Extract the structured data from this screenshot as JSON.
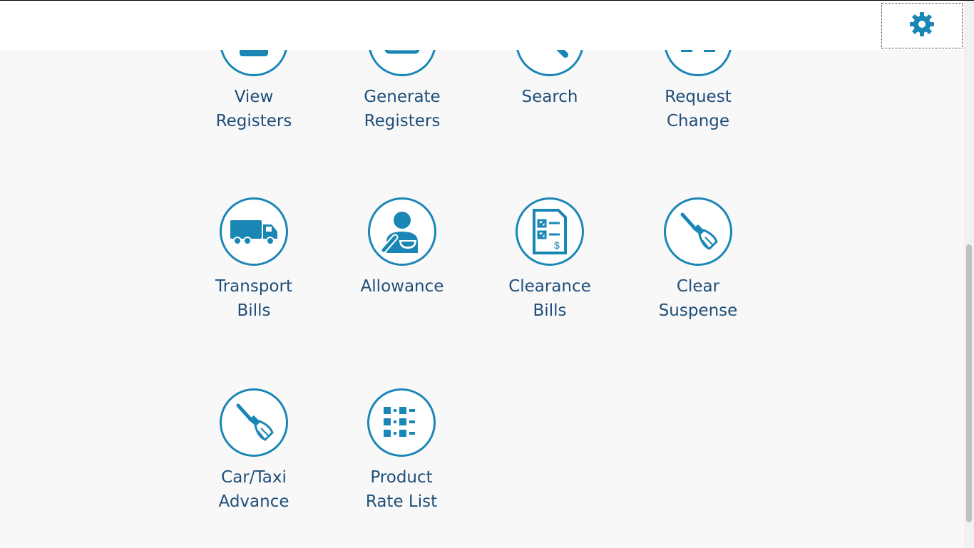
{
  "header": {
    "settings_icon": "gear-icon",
    "accent": "#1a86b5"
  },
  "tiles": [
    {
      "label": "View\nRegisters",
      "icon": "register-book-icon"
    },
    {
      "label": "Generate\nRegisters",
      "icon": "generate-register-icon"
    },
    {
      "label": "Search",
      "icon": "magnifier-icon"
    },
    {
      "label": "Request\nChange",
      "icon": "request-change-icon"
    },
    {
      "label": "Transport\nBills",
      "icon": "truck-icon"
    },
    {
      "label": "Allowance",
      "icon": "person-bowl-icon"
    },
    {
      "label": "Clearance\nBills",
      "icon": "checklist-bill-icon"
    },
    {
      "label": "Clear\nSuspense",
      "icon": "broom-icon"
    },
    {
      "label": "Car/Taxi\nAdvance",
      "icon": "broom-icon"
    },
    {
      "label": "Product\nRate List",
      "icon": "rate-list-icon"
    }
  ],
  "colors": {
    "text": "#1f4e79",
    "icon": "#1a86b5",
    "background": "#f8f8f8"
  }
}
